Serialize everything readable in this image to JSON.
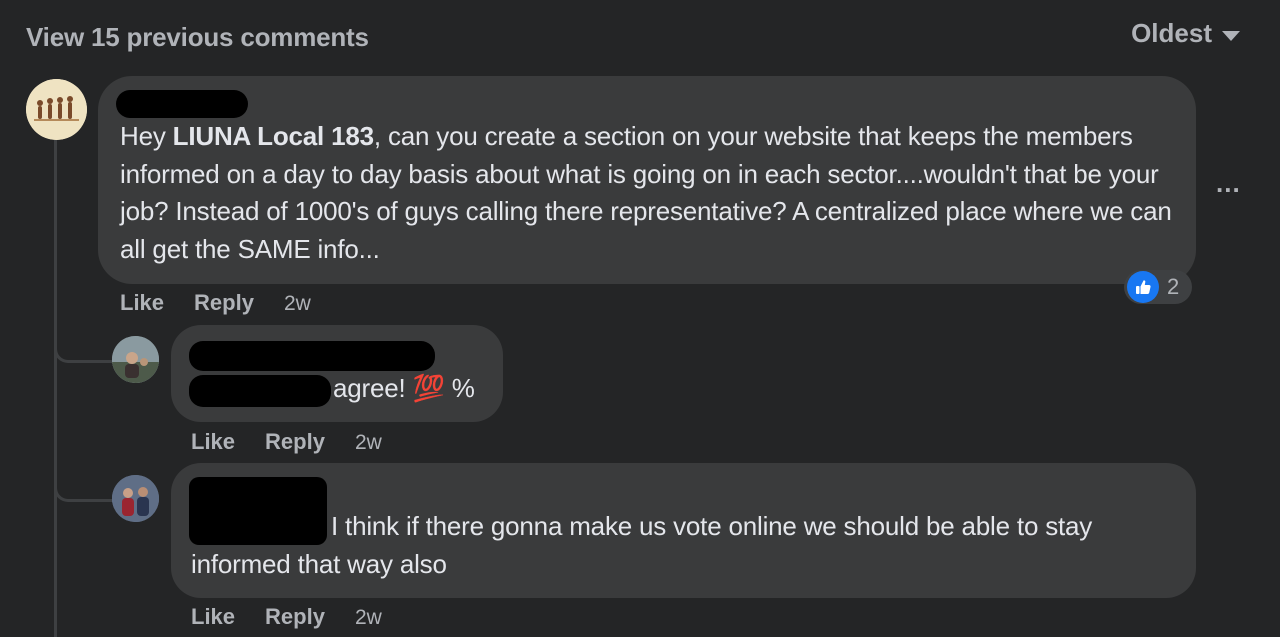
{
  "header": {
    "view_previous": "View 15 previous comments",
    "sort_label": "Oldest"
  },
  "comments": [
    {
      "mention": "LIUNA Local 183",
      "text_before": "Hey ",
      "text_after": ", can you create a section on your website that keeps the members informed on a day to day basis about what is going on in each sector....wouldn't that be your job? Instead of 1000's of guys calling there representative? A centralized place where we can all get the SAME info...",
      "like_label": "Like",
      "reply_label": "Reply",
      "time": "2w",
      "reaction_count": "2",
      "more_label": "..."
    },
    {
      "text": "agree! 💯 %",
      "like_label": "Like",
      "reply_label": "Reply",
      "time": "2w"
    },
    {
      "text": "I think if there gonna make us vote online we should be able to stay informed that way also",
      "like_label": "Like",
      "reply_label": "Reply",
      "time": "2w"
    }
  ],
  "colors": {
    "background": "#242526",
    "bubble": "#3a3b3c",
    "like_blue": "#1877f2",
    "secondary_text": "#b0b3b8"
  }
}
